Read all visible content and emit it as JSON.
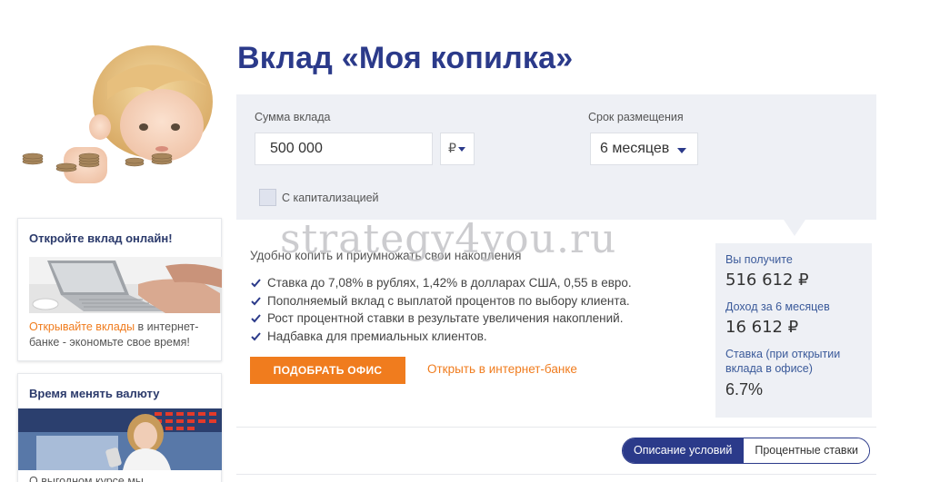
{
  "page": {
    "title": "Вклад «Моя копилка»"
  },
  "sidebar": {
    "card_online": {
      "title": "Откройте вклад онлайн!",
      "link_text": "Открывайте вклады",
      "text": " в интернет-банке - экономьте свое время!"
    },
    "card_currency": {
      "title": "Время менять валюту",
      "text": "О выгодном курсе мы"
    }
  },
  "calculator": {
    "sum_label": "Сумма вклада",
    "sum_value": "500 000",
    "currency": "₽",
    "term_label": "Срок размещения",
    "term_value": "6 месяцев",
    "capitalization_label": "С капитализацией",
    "capitalization_checked": false
  },
  "description": {
    "title": "Удобно копить и приумножать свои накопления",
    "features": [
      "Ставка до 7,08% в рублях, 1,42% в долларах США, 0,55 в евро.",
      "Пополняемый вклад с выплатой процентов по выбору клиента.",
      "Рост процентной ставки в результате увеличения накоплений.",
      "Надбавка для премиальных клиентов."
    ],
    "office_button": "ПОДОБРАТЬ ОФИС",
    "online_link": "Открыть в интернет-банке"
  },
  "result": {
    "receive_label": "Вы получите",
    "receive_value": "516 612 ₽",
    "income_label": "Доход за 6 месяцев",
    "income_value": "16 612 ₽",
    "rate_label": "Ставка (при открытии вклада в офисе)",
    "rate_value": "6.7%"
  },
  "tabs": {
    "conditions": "Описание условий",
    "rates": "Процентные ставки"
  },
  "watermark": "strategy4you.ru",
  "colors": {
    "brand_blue": "#2b3a8a",
    "accent_orange": "#f07c1e",
    "panel_bg": "#eef0f5"
  }
}
